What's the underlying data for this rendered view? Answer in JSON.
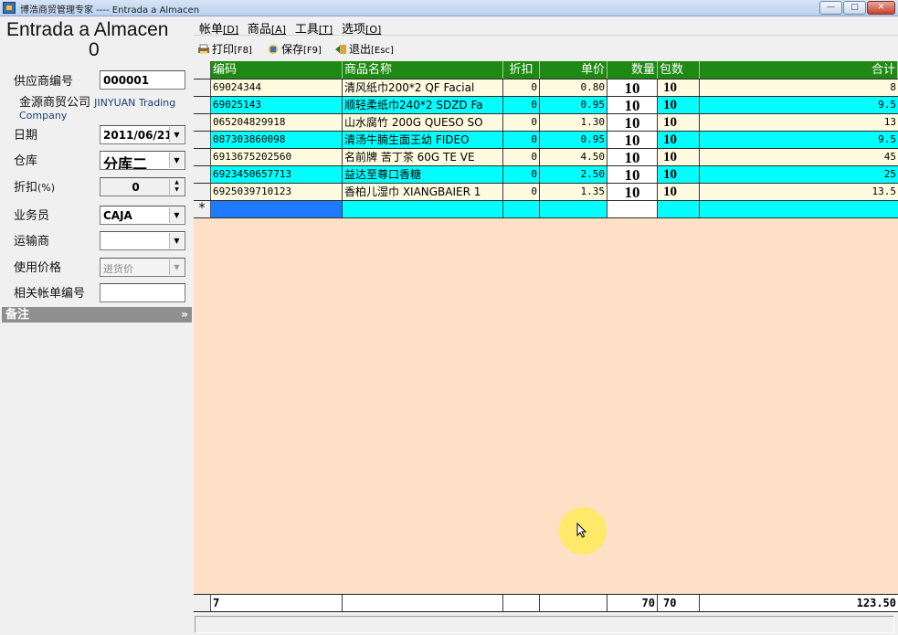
{
  "window": {
    "title": "博浩商贸管理专家 ---- Entrada a Almacen",
    "minimize_glyph": "—",
    "maximize_glyph": "□",
    "close_glyph": "✕"
  },
  "form": {
    "title": "Entrada a Almacen",
    "number": "0",
    "supplier_code_label": "供应商编号",
    "supplier_code": "000001",
    "supplier_name": "金源商贸公司",
    "supplier_name_en": "JINYUAN Trading Company",
    "date_label": "日期",
    "date": "2011/06/21",
    "warehouse_label": "仓库",
    "warehouse": "分库二",
    "discount_label": "折扣",
    "discount_unit": "(%)",
    "discount": "0",
    "salesman_label": "业务员",
    "salesman": "CAJA",
    "carrier_label": "运输商",
    "carrier": "",
    "price_type_label": "使用价格",
    "price_type": "进货价",
    "related_bill_label": "相关帐单编号",
    "related_bill": "",
    "remarks_label": "备注",
    "remarks_expand": "»"
  },
  "menu": {
    "items": [
      {
        "label": "帐单",
        "key": "[D]"
      },
      {
        "label": "商品",
        "key": "[A]"
      },
      {
        "label": "工具",
        "key": "[T]"
      },
      {
        "label": "选项",
        "key": "[O]"
      }
    ]
  },
  "toolbar": {
    "print_label": "打印",
    "print_key": "[F8]",
    "save_label": "保存",
    "save_key": "[F9]",
    "exit_label": "退出",
    "exit_key": "[Esc]"
  },
  "table": {
    "headers": [
      "编码",
      "商品名称",
      "折扣",
      "单价",
      "数量",
      "包数",
      "合计"
    ],
    "rows": [
      {
        "code": "69024344",
        "name": "清风纸巾200*2 QF Facial",
        "disc": "0",
        "price": "0.80",
        "qty": "10",
        "packs": "10",
        "total": "8"
      },
      {
        "code": "69025143",
        "name": "顺轻柔纸巾240*2 SDZD Fa",
        "disc": "0",
        "price": "0.95",
        "qty": "10",
        "packs": "10",
        "total": "9.5"
      },
      {
        "code": "065204829918",
        "name": "山水腐竹 200G QUESO SO",
        "disc": "0",
        "price": "1.30",
        "qty": "10",
        "packs": "10",
        "total": "13"
      },
      {
        "code": "087303860098",
        "name": "清汤牛腩生面王幼 FIDEO",
        "disc": "0",
        "price": "0.95",
        "qty": "10",
        "packs": "10",
        "total": "9.5"
      },
      {
        "code": "6913675202560",
        "name": "名前牌 苦丁茶 60G TE VE",
        "disc": "0",
        "price": "4.50",
        "qty": "10",
        "packs": "10",
        "total": "45"
      },
      {
        "code": "6923450657713",
        "name": "益达至尊口香糖",
        "disc": "0",
        "price": "2.50",
        "qty": "10",
        "packs": "10",
        "total": "25"
      },
      {
        "code": "6925039710123",
        "name": "香柏儿湿巾 XIANGBAIER 1",
        "disc": "0",
        "price": "1.35",
        "qty": "10",
        "packs": "10",
        "total": "13.5"
      }
    ],
    "new_row_marker": "*",
    "row_colors": [
      "#fffbe0",
      "#00ffff"
    ]
  },
  "totals": {
    "count": "7",
    "qty": "70",
    "packs": "70",
    "amount": "123.50"
  },
  "colors": {
    "header_bg": "#1f8a13",
    "grid_bg": "#fde0c6",
    "new_row_bg": "#00ffff",
    "selected_cell_bg": "#1e7bff"
  }
}
